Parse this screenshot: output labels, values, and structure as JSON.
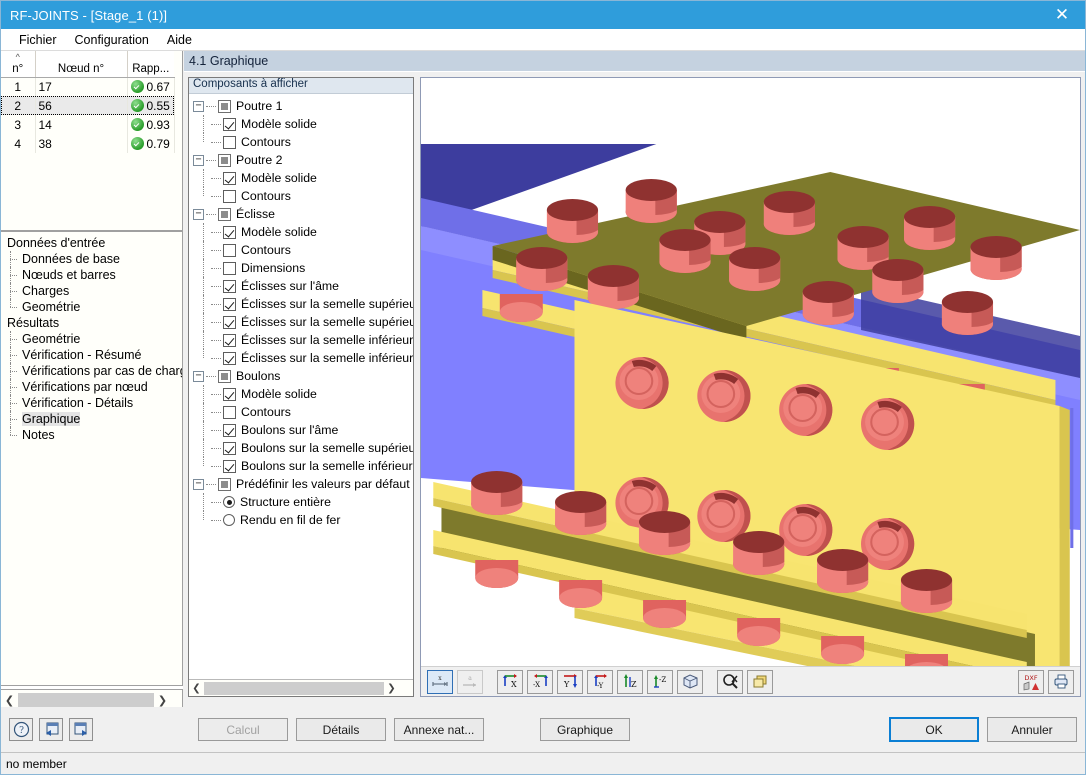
{
  "window": {
    "title": "RF-JOINTS - [Stage_1 (1)]",
    "close_icon": "close-icon"
  },
  "menu": {
    "items": [
      "Fichier",
      "Configuration",
      "Aide"
    ]
  },
  "table": {
    "headers": [
      "n°",
      "Nœud n°",
      "Rapp..."
    ],
    "rows": [
      {
        "n": "1",
        "node": "17",
        "ratio": "0.67",
        "status": "ok"
      },
      {
        "n": "2",
        "node": "56",
        "ratio": "0.55",
        "status": "ok"
      },
      {
        "n": "3",
        "node": "14",
        "ratio": "0.93",
        "status": "ok"
      },
      {
        "n": "4",
        "node": "38",
        "ratio": "0.79",
        "status": "ok"
      }
    ]
  },
  "nav": {
    "groups": [
      {
        "label": "Données d'entrée",
        "items": [
          "Données de base",
          "Nœuds et barres",
          "Charges",
          "Geométrie"
        ]
      },
      {
        "label": "Résultats",
        "items": [
          "Geométrie",
          "Vérification - Résumé",
          "Vérifications par cas de charge",
          "Vérifications par nœud",
          "Vérification - Détails",
          "Graphique",
          "Notes"
        ],
        "active": "Graphique"
      }
    ]
  },
  "panel": {
    "header": "4.1 Graphique"
  },
  "tree": {
    "header": "Composants à afficher",
    "nodes": [
      {
        "level": 0,
        "type": "group",
        "label": "Poutre 1",
        "expanded": true
      },
      {
        "level": 1,
        "type": "check",
        "label": "Modèle solide",
        "checked": true
      },
      {
        "level": 1,
        "type": "check",
        "label": "Contours",
        "checked": false,
        "last": true
      },
      {
        "level": 0,
        "type": "group",
        "label": "Poutre 2",
        "expanded": true
      },
      {
        "level": 1,
        "type": "check",
        "label": "Modèle solide",
        "checked": true
      },
      {
        "level": 1,
        "type": "check",
        "label": "Contours",
        "checked": false,
        "last": true
      },
      {
        "level": 0,
        "type": "group",
        "label": "Éclisse",
        "expanded": true
      },
      {
        "level": 1,
        "type": "check",
        "label": "Modèle solide",
        "checked": true
      },
      {
        "level": 1,
        "type": "check",
        "label": "Contours",
        "checked": false
      },
      {
        "level": 1,
        "type": "check",
        "label": "Dimensions",
        "checked": false
      },
      {
        "level": 1,
        "type": "check",
        "label": "Éclisses sur l'âme",
        "checked": true
      },
      {
        "level": 1,
        "type": "check",
        "label": "Éclisses sur la semelle supérieur",
        "checked": true
      },
      {
        "level": 1,
        "type": "check",
        "label": "Éclisses sur la semelle supérieur",
        "checked": true
      },
      {
        "level": 1,
        "type": "check",
        "label": "Éclisses sur la semelle inférieur",
        "checked": true
      },
      {
        "level": 1,
        "type": "check",
        "label": "Éclisses sur la semelle inférieur",
        "checked": true,
        "last": true
      },
      {
        "level": 0,
        "type": "group",
        "label": "Boulons",
        "expanded": true
      },
      {
        "level": 1,
        "type": "check",
        "label": "Modèle solide",
        "checked": true
      },
      {
        "level": 1,
        "type": "check",
        "label": "Contours",
        "checked": false
      },
      {
        "level": 1,
        "type": "check",
        "label": "Boulons sur l'âme",
        "checked": true
      },
      {
        "level": 1,
        "type": "check",
        "label": "Boulons sur la semelle supérieur",
        "checked": true
      },
      {
        "level": 1,
        "type": "check",
        "label": "Boulons sur la semelle inférieur",
        "checked": true,
        "last": true
      },
      {
        "level": 0,
        "type": "group",
        "label": "Prédéfinir les valeurs par défaut",
        "expanded": true
      },
      {
        "level": 1,
        "type": "radio",
        "label": "Structure entière",
        "checked": true
      },
      {
        "level": 1,
        "type": "radio",
        "label": "Rendu en fil de fer",
        "checked": false,
        "last": true
      }
    ]
  },
  "viewport_toolbar": {
    "buttons": [
      {
        "name": "dimension-x-icon",
        "selected": true
      },
      {
        "name": "annotation-icon",
        "disabled": true
      },
      {
        "name": "view-x-icon",
        "axis": "X"
      },
      {
        "name": "view-minus-x-icon",
        "axis": "-X"
      },
      {
        "name": "view-y-icon",
        "axis": "Y"
      },
      {
        "name": "view-minus-y-icon",
        "axis": "-Y"
      },
      {
        "name": "view-z-icon",
        "axis": "Z"
      },
      {
        "name": "view-minus-z-icon",
        "axis": "-Z"
      },
      {
        "name": "isometric-view-icon"
      },
      {
        "name": "zoom-reset-icon"
      },
      {
        "name": "render-mode-icon"
      }
    ],
    "right_buttons": [
      {
        "name": "dxf-export-icon",
        "label": "DXF"
      },
      {
        "name": "print-icon"
      }
    ]
  },
  "bottom": {
    "icon_buttons": [
      "help-icon",
      "prev-panel-icon",
      "next-panel-icon"
    ],
    "calcul": "Calcul",
    "details": "Détails",
    "annexe": "Annexe nat...",
    "graphique": "Graphique",
    "ok": "OK",
    "cancel": "Annuler"
  },
  "status": {
    "text": "no member"
  },
  "colors": {
    "titlebar": "#2f9ddb",
    "beam": "#8080ff",
    "beam_dark": "#3d3d9e",
    "plate": "#f7e46f",
    "plate_olive": "#7e7a2c",
    "bolt": "#e8736e",
    "bolt_dark": "#8f2f2f",
    "accent": "#0b7fd4"
  }
}
